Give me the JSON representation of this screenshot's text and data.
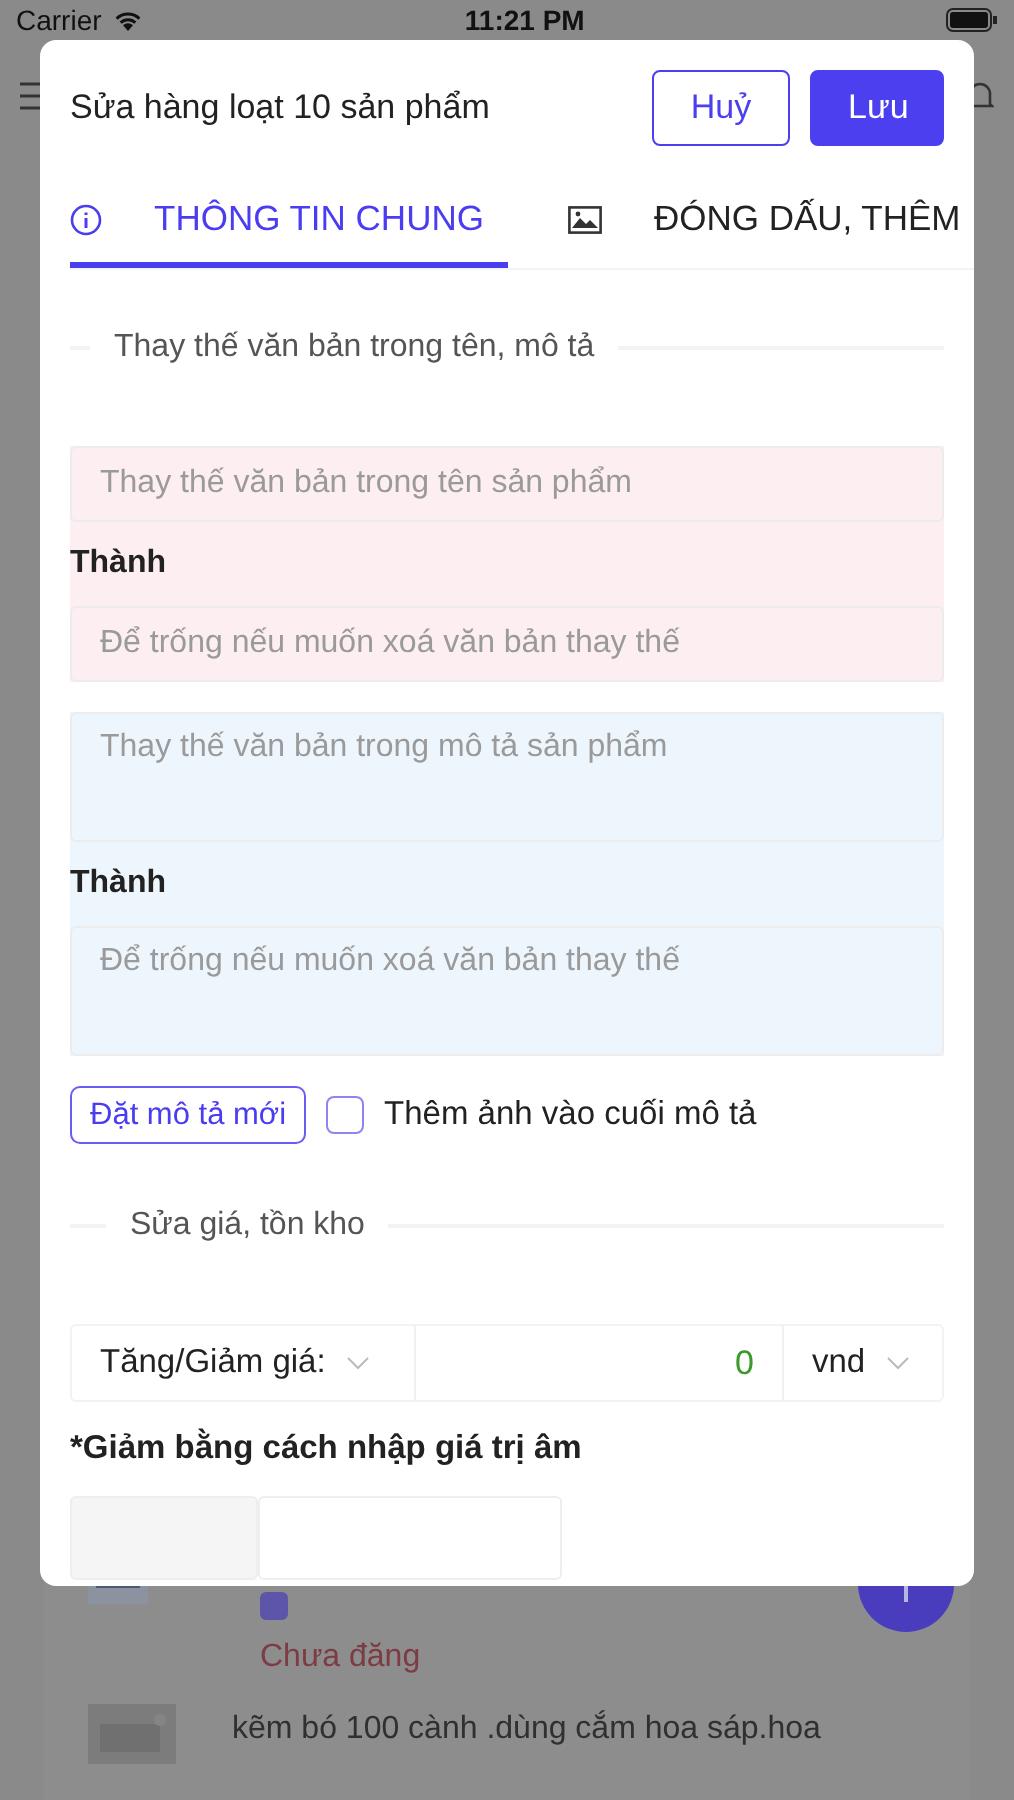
{
  "status_bar": {
    "carrier": "Carrier",
    "time": "11:21 PM"
  },
  "background_list": [
    {
      "checked": true,
      "status": "Chưa đăng"
    },
    {
      "title": "kẽm bó 100 cành .dùng cắm hoa sáp.hoa"
    }
  ],
  "dialog": {
    "title": "Sửa hàng loạt 10 sản phẩm",
    "buttons": [
      {
        "label": "Huỷ",
        "kind": "secondary"
      },
      {
        "label": "Lưu",
        "kind": "primary"
      }
    ],
    "tabs": [
      {
        "label": "THÔNG TIN CHUNG",
        "selected": true
      },
      {
        "label": "ĐÓNG DẤU, THÊM",
        "selected": false
      }
    ],
    "replace_section": {
      "heading": "Thay thế văn bản trong tên, mô tả",
      "groups": [
        {
          "color": "#fdeef1",
          "multiline": false,
          "find_placeholder": "Thay thế văn bản trong tên sản phẩm",
          "label": "Thành",
          "replace_placeholder": "Để trống nếu muốn xoá văn bản thay thế"
        },
        {
          "color": "#eef6fd",
          "multiline": true,
          "find_placeholder": "Thay thế văn bản trong mô tả sản phẩm",
          "label": "Thành",
          "replace_placeholder": "Để trống nếu muốn xoá văn bản thay thế"
        }
      ],
      "button": "Đặt mô tả mới",
      "checkbox": {
        "label": "Thêm ảnh vào cuối mô tả",
        "checked": false
      }
    },
    "price_section": {
      "heading": "Sửa giá, tồn kho",
      "mode": "Tăng/Giảm giá:",
      "value": "0",
      "unit": "vnd",
      "note": "*Giảm bằng cách nhập giá trị âm"
    }
  }
}
